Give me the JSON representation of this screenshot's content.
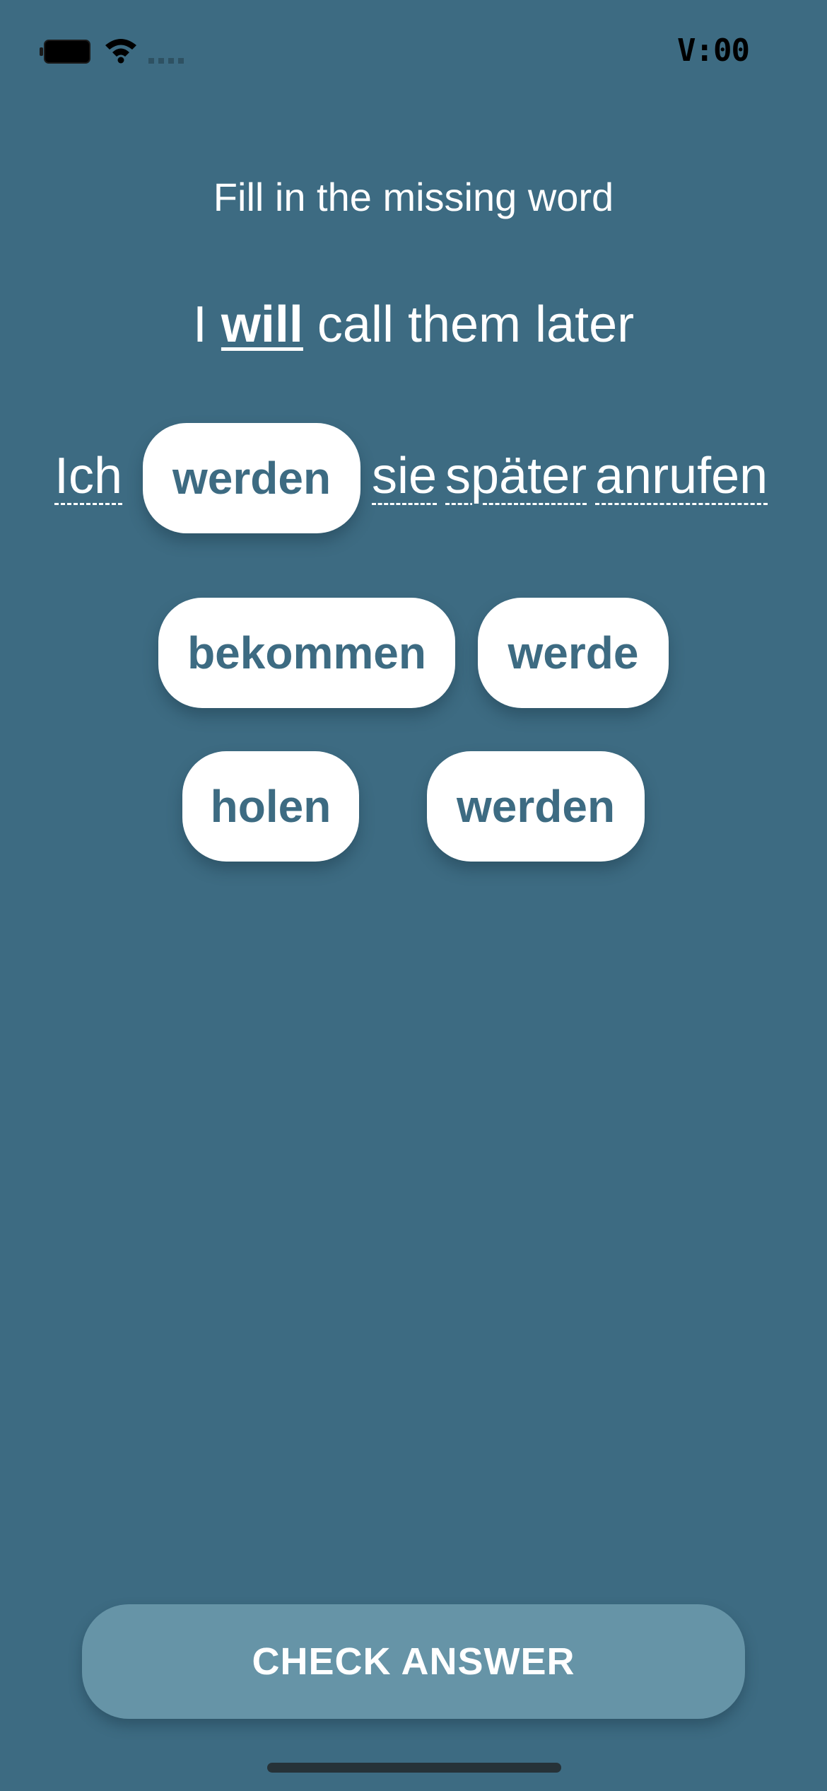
{
  "status_bar": {
    "time": "V:00",
    "icons": [
      "battery-icon",
      "wifi-icon",
      "signal-icon"
    ]
  },
  "exercise": {
    "instruction": "Fill in the missing word",
    "prompt": {
      "before": "I ",
      "keyword": "will",
      "after": " call them later"
    },
    "sentence": {
      "word_1": "Ich",
      "placed_answer": "werden",
      "word_2": "sie",
      "word_3": "später",
      "word_4": "anrufen"
    },
    "options": [
      "bekommen",
      "werde",
      "holen",
      "werden"
    ]
  },
  "actions": {
    "check_label": "CHECK ANSWER"
  },
  "colors": {
    "background": "#3d6b82",
    "chip": "#ffffff",
    "chip_text": "#3d6b82",
    "button": "#6694a7"
  }
}
